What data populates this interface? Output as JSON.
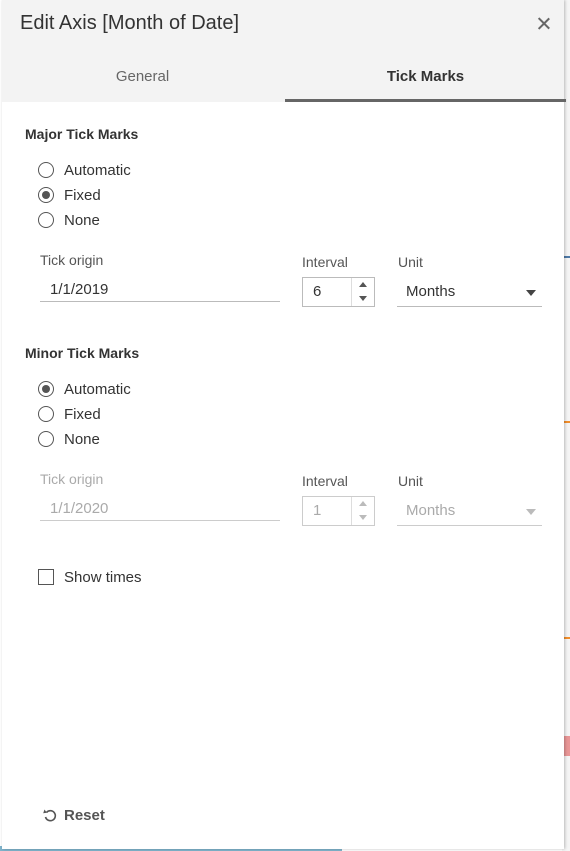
{
  "dialog": {
    "title": "Edit Axis [Month of Date]",
    "close_icon": "close-icon"
  },
  "tabs": [
    {
      "label": "General",
      "selected": false
    },
    {
      "label": "Tick Marks",
      "selected": true
    }
  ],
  "major": {
    "title": "Major Tick Marks",
    "options": [
      {
        "label": "Automatic",
        "checked": false
      },
      {
        "label": "Fixed",
        "checked": true
      },
      {
        "label": "None",
        "checked": false
      }
    ],
    "tick_origin_label": "Tick origin",
    "tick_origin_value": "1/1/2019",
    "interval_label": "Interval",
    "interval_value": "6",
    "unit_label": "Unit",
    "unit_value": "Months",
    "enabled": true
  },
  "minor": {
    "title": "Minor Tick Marks",
    "options": [
      {
        "label": "Automatic",
        "checked": true
      },
      {
        "label": "Fixed",
        "checked": false
      },
      {
        "label": "None",
        "checked": false
      }
    ],
    "tick_origin_label": "Tick origin",
    "tick_origin_value": "1/1/2020",
    "interval_label": "Interval",
    "interval_value": "1",
    "unit_label": "Unit",
    "unit_value": "Months",
    "enabled": false
  },
  "show_times": {
    "label": "Show times",
    "checked": false
  },
  "footer": {
    "reset_label": "Reset",
    "reset_icon": "undo-icon"
  },
  "colors": {
    "header_bg": "#f3f3f3",
    "tab_underline": "#666666",
    "text": "#333333",
    "disabled_text": "#aaaaaa"
  }
}
